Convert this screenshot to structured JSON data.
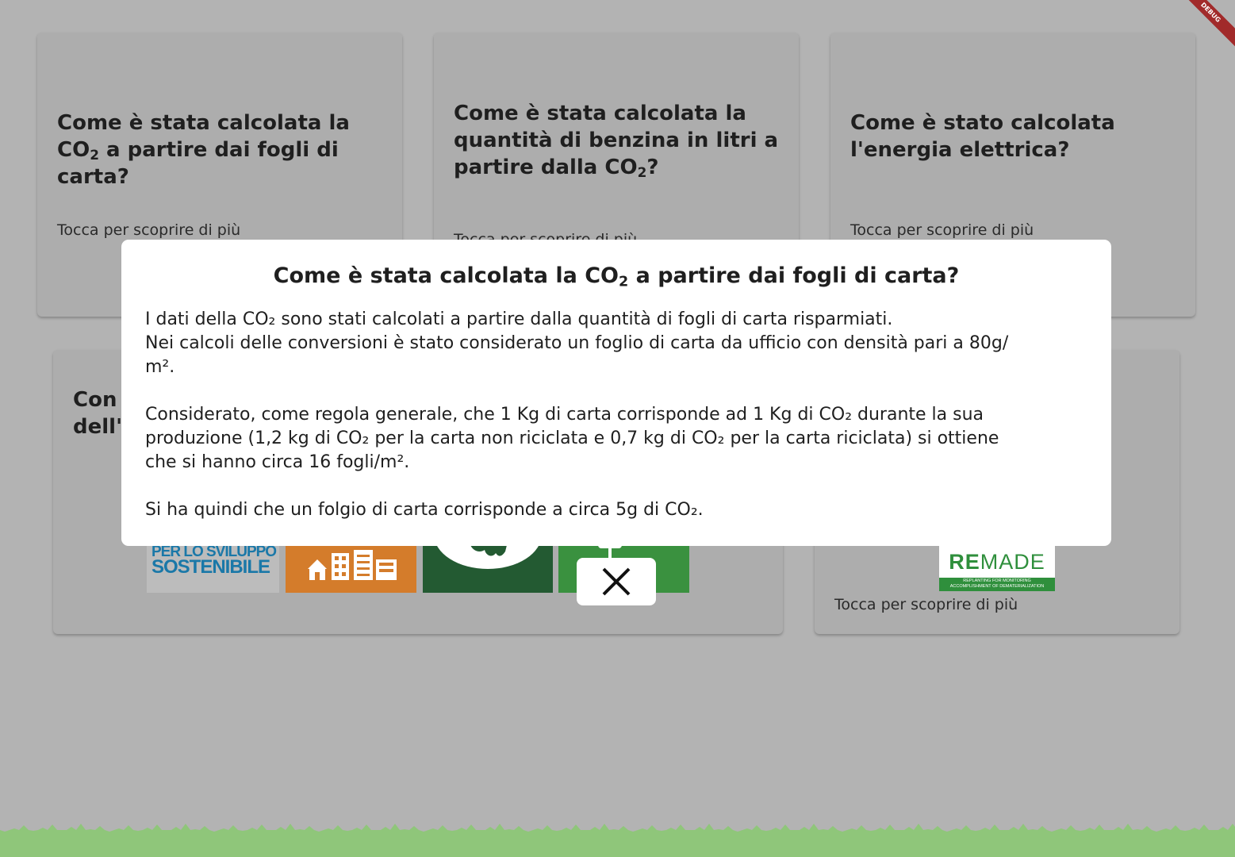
{
  "cards": [
    {
      "title_pre": "Come è stata calcolata la CO",
      "title_sub": "2",
      "title_post": " a partire dai fogli di carta?",
      "more": "Tocca per scoprire di più"
    },
    {
      "title_pre": "Come è stata calcolata la quantità di benzina in litri a partire dalla CO",
      "title_sub": "2",
      "title_post": "?",
      "more": "Tocca per scoprire di più"
    },
    {
      "title": "Come è stato calcolata l'energia elettrica?",
      "more": "Tocca per scoprire di più"
    },
    {
      "title_line1": "Con",
      "title_line2": "dell'a"
    },
    {
      "more": "Tocca per scoprire di più"
    }
  ],
  "sdg_logo": {
    "line1": "PER LO SVILUPPO",
    "line2": "SOSTENIBILE"
  },
  "remade_logo": {
    "word_bold": "RE",
    "word_rest": "MADE",
    "tagline_1": "REPLANTING FOR MONITORING",
    "tagline_2": "ACCOMPLISHMENT OF DEMATERIALIZATION"
  },
  "dialog": {
    "title_pre": "Come è stata calcolata la CO",
    "title_sub": "2",
    "title_post": " a partire dai fogli di carta?",
    "p1_a": "I dati della CO",
    "p1_b": " sono stati calcolati a partire dalla quantità di fogli di carta risparmiati.",
    "p1_c": "Nei calcoli delle conversioni è stato considerato un foglio di carta da ufficio con densità pari a 80g/",
    "p1_d": "m².",
    "p2_a": "Considerato, come regola generale, che 1 Kg di carta corrisponde ad 1 Kg di CO",
    "p2_b": " durante la sua",
    "p2_c": "produzione (1,2 kg di CO",
    "p2_d": " per la carta non riciclata e 0,7 kg di CO",
    "p2_e": " per la carta riciclata) si ottiene",
    "p2_f": "che si hanno circa 16 fogli/m².",
    "p3_a": "Si ha quindi che un folgio di carta corrisponde a circa 5g di CO",
    "p3_b": ".",
    "sub": "₂"
  },
  "debug_banner": "DEBUG",
  "colors": {
    "background": "#b3b3b3",
    "card": "#adadad",
    "grass": "#8fc67a",
    "remade_green": "#2f8f3c",
    "sdg_orange": "#d47c2b",
    "sdg_darkgreen": "#235a32",
    "sdg_green": "#3a913f"
  }
}
